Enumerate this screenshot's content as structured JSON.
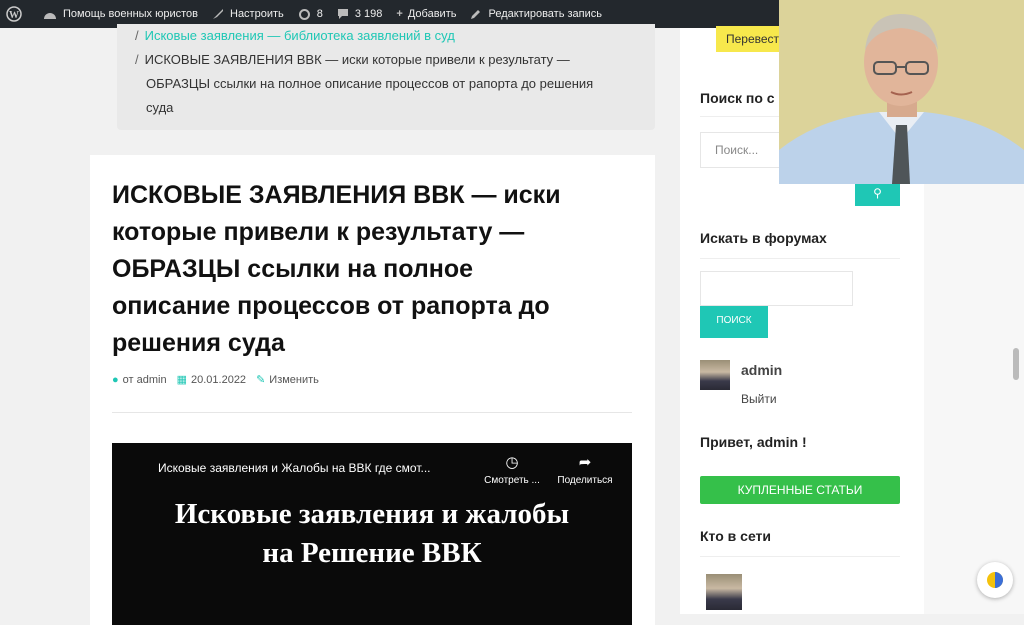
{
  "adminbar": {
    "site_name": "Помощь военных юристов",
    "customize": "Настроить",
    "updates_count": "8",
    "comments_count": "3 198",
    "add_new": "Добавить",
    "edit_post": "Редактировать запись"
  },
  "breadcrumb": {
    "link": "Исковые заявления — библиотека заявлений в суд",
    "current_line1": "ИСКОВЫЕ ЗАЯВЛЕНИЯ ВВК — иски которые привели к результату —",
    "current_line2": "ОБРАЗЦЫ ссылки на полное описание процессов от рапорта до решения",
    "current_line3": "суда",
    "separator": "/"
  },
  "article": {
    "title_line1": "ИСКОВЫЕ ЗАЯВЛЕНИЯ ВВК — иски",
    "title_line2": "которые привели к результату —",
    "title_line3": "ОБРАЗЦЫ ссылки на полное",
    "title_line4": "описание процессов от рапорта до",
    "title_line5": "решения суда",
    "author": "от admin",
    "date": "20.01.2022",
    "edit": "Изменить"
  },
  "video": {
    "title": "Исковые заявления и Жалобы на ВВК где смот...",
    "watch_label": "Смотреть ...",
    "share_label": "Поделиться",
    "overlay_line1": "Исковые заявления и жалобы",
    "overlay_line2": "на Решение ВВК"
  },
  "sidebar": {
    "translate_label": "Перевест",
    "search_title": "Поиск по с",
    "search_placeholder": "Поиск...",
    "forum_title": "Искать в форумах",
    "forum_button": "ПОИСК",
    "user_name": "admin",
    "logout": "Выйти",
    "greeting": "Привет, admin !",
    "bought_button": "КУПЛЕННЫЕ СТАТЬИ",
    "online_title": "Кто в сети"
  },
  "colors": {
    "accent": "#1fc7b5",
    "admin_bar": "#23282d",
    "green_button": "#35c04a"
  }
}
